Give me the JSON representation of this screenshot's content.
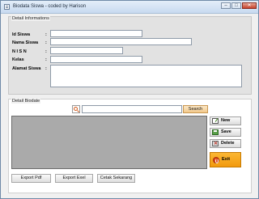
{
  "window": {
    "title": "Biodata Siswa - coded by Harison",
    "controls": {
      "minimize": "–",
      "maximize": "□",
      "close": "✕"
    }
  },
  "detail_info": {
    "caption": "Detail Informations",
    "fields": [
      {
        "label": "Id Siswa",
        "value": ""
      },
      {
        "label": "Nama Siswa",
        "value": ""
      },
      {
        "label": "N I S N",
        "value": ""
      },
      {
        "label": "Kelas",
        "value": ""
      },
      {
        "label": "Alamat Siswa",
        "value": ""
      }
    ],
    "colon": ":"
  },
  "detail_biodata": {
    "caption": "Detail Biodate",
    "search": {
      "value": "",
      "button": "Search"
    },
    "actions": {
      "new": "New",
      "save": "Save",
      "delete": "Delete",
      "exit": "Exit"
    },
    "bottom": {
      "export_pdf": "Export Pdf",
      "export_excel": "Export Exel",
      "print": "Cetak Sekarang"
    }
  },
  "colors": {
    "exit_button": "#f5a623",
    "search_button": "#f3c98b",
    "grid_background": "#aaaaaa"
  }
}
